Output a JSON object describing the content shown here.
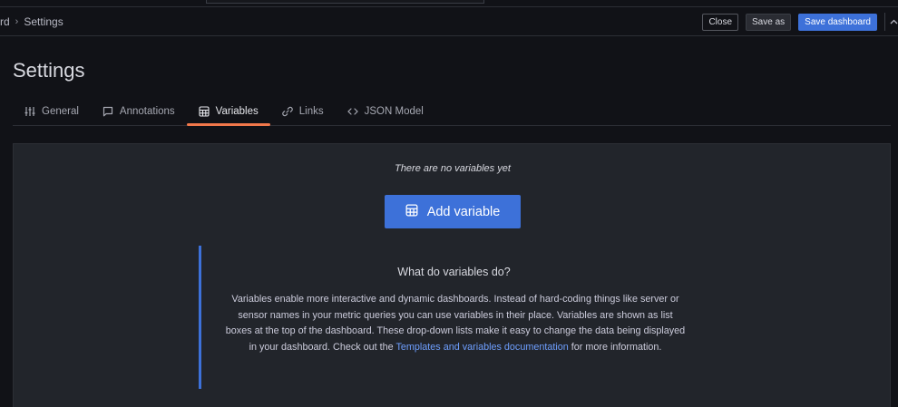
{
  "toolbar": {
    "breadcrumb": [
      {
        "label": "rd"
      },
      {
        "label": "Settings"
      }
    ],
    "separator": "›",
    "close_label": "Close",
    "save_as_label": "Save as",
    "save_dashboard_label": "Save dashboard"
  },
  "page": {
    "title": "Settings"
  },
  "tabs": [
    {
      "label": "General",
      "icon": "sliders-icon",
      "active": false
    },
    {
      "label": "Annotations",
      "icon": "comment-icon",
      "active": false
    },
    {
      "label": "Variables",
      "icon": "calculator-icon",
      "active": true
    },
    {
      "label": "Links",
      "icon": "link-icon",
      "active": false
    },
    {
      "label": "JSON Model",
      "icon": "code-icon",
      "active": false
    }
  ],
  "variables": {
    "empty_message": "There are no variables yet",
    "add_button_label": "Add variable",
    "info": {
      "heading": "What do variables do?",
      "body": "Variables enable more interactive and dynamic dashboards. Instead of hard-coding things like server or sensor names in your metric queries you can use variables in their place. Variables are shown as list boxes at the top of the dashboard. These drop-down lists make it easy to change the data being displayed in your dashboard. Check out the ",
      "link_label": "Templates and variables documentation",
      "body_suffix": " for more information."
    }
  },
  "colors": {
    "background": "#111217",
    "panel": "#22252b",
    "primary": "#3d71d9",
    "active_tab_underline": "#f2784b",
    "link": "#6e9fff"
  }
}
